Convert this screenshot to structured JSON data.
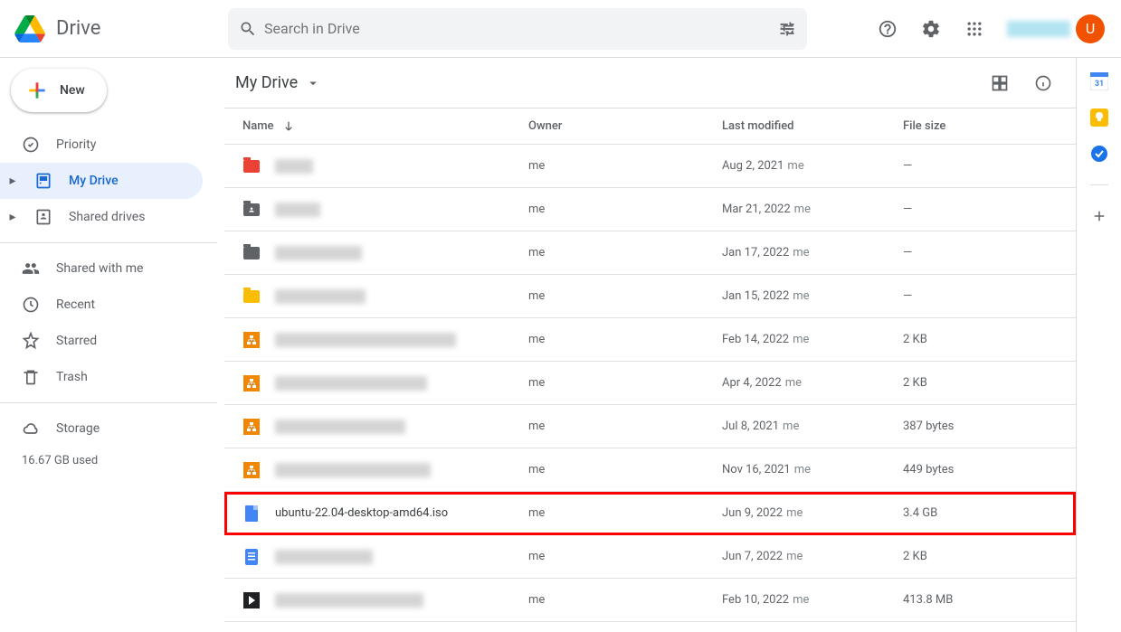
{
  "app": {
    "name": "Drive"
  },
  "search": {
    "placeholder": "Search in Drive"
  },
  "avatar": {
    "letter": "U"
  },
  "new_button": {
    "label": "New"
  },
  "sidebar": {
    "items": [
      {
        "label": "Priority"
      },
      {
        "label": "My Drive"
      },
      {
        "label": "Shared drives"
      },
      {
        "label": "Shared with me"
      },
      {
        "label": "Recent"
      },
      {
        "label": "Starred"
      },
      {
        "label": "Trash"
      },
      {
        "label": "Storage"
      }
    ],
    "storage_used": "16.67 GB used"
  },
  "breadcrumb": {
    "title": "My Drive"
  },
  "columns": {
    "name": "Name",
    "owner": "Owner",
    "modified": "Last modified",
    "size": "File size"
  },
  "files": [
    {
      "name": "",
      "owner": "me",
      "modified": "Aug 2, 2021",
      "modified_by": "me",
      "size": "—",
      "icon": "folder",
      "color": "#ea4335",
      "blurred": true,
      "blur_w": 42,
      "highlighted": false
    },
    {
      "name": "",
      "owner": "me",
      "modified": "Mar 21, 2022",
      "modified_by": "me",
      "size": "—",
      "icon": "person-folder",
      "color": "#5f6368",
      "blurred": true,
      "blur_w": 50,
      "highlighted": false
    },
    {
      "name": "",
      "owner": "me",
      "modified": "Jan 17, 2022",
      "modified_by": "me",
      "size": "—",
      "icon": "folder",
      "color": "#5f6368",
      "blurred": true,
      "blur_w": 96,
      "highlighted": false
    },
    {
      "name": "",
      "owner": "me",
      "modified": "Jan 15, 2022",
      "modified_by": "me",
      "size": "—",
      "icon": "folder",
      "color": "#fbbc04",
      "blurred": true,
      "blur_w": 100,
      "highlighted": false
    },
    {
      "name": "",
      "owner": "me",
      "modified": "Feb 14, 2022",
      "modified_by": "me",
      "size": "2 KB",
      "icon": "drawio",
      "color": "#f08705",
      "blurred": true,
      "blur_w": 200,
      "highlighted": false
    },
    {
      "name": "",
      "owner": "me",
      "modified": "Apr 4, 2022",
      "modified_by": "me",
      "size": "2 KB",
      "icon": "drawio",
      "color": "#f08705",
      "blurred": true,
      "blur_w": 168,
      "highlighted": false
    },
    {
      "name": "",
      "owner": "me",
      "modified": "Jul 8, 2021",
      "modified_by": "me",
      "size": "387 bytes",
      "icon": "drawio",
      "color": "#f08705",
      "blurred": true,
      "blur_w": 144,
      "highlighted": false
    },
    {
      "name": "",
      "owner": "me",
      "modified": "Nov 16, 2021",
      "modified_by": "me",
      "size": "449 bytes",
      "icon": "drawio",
      "color": "#f08705",
      "blurred": true,
      "blur_w": 172,
      "highlighted": false
    },
    {
      "name": "ubuntu-22.04-desktop-amd64.iso",
      "owner": "me",
      "modified": "Jun 9, 2022",
      "modified_by": "me",
      "size": "3.4 GB",
      "icon": "file",
      "color": "#4285f4",
      "blurred": false,
      "blur_w": 0,
      "highlighted": true
    },
    {
      "name": "",
      "owner": "me",
      "modified": "Jun 7, 2022",
      "modified_by": "me",
      "size": "2 KB",
      "icon": "doc",
      "color": "#4285f4",
      "blurred": true,
      "blur_w": 108,
      "highlighted": false
    },
    {
      "name": "",
      "owner": "me",
      "modified": "Feb 10, 2022",
      "modified_by": "me",
      "size": "413.8 MB",
      "icon": "video",
      "color": "#202124",
      "blurred": true,
      "blur_w": 164,
      "highlighted": false
    }
  ]
}
